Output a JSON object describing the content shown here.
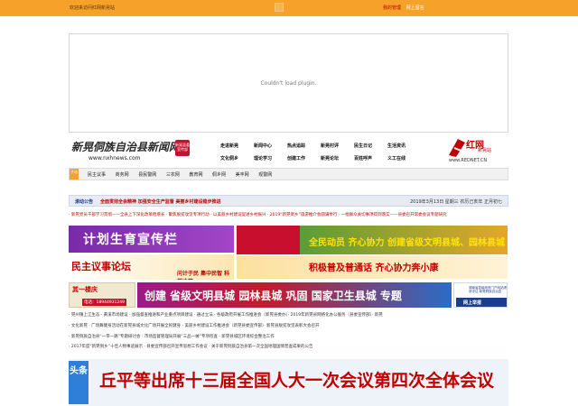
{
  "topbar": {
    "welcome": "欢迎来访问红网新晃站",
    "login": "我的管理",
    "help": "网上留言"
  },
  "plugin": {
    "message": "Couldn't load plugin."
  },
  "header": {
    "logo_text": "新晃侗族自治县新闻网",
    "logo_url": "www.nxhnews.com",
    "seal": "新晃县委宣传部",
    "nav": [
      [
        "走进新晃",
        "新闻中心",
        "热点追踪",
        "新晃村评",
        "民生日记",
        "生活资讯"
      ],
      [
        "文化侗乡",
        "理论学习",
        "创建工作",
        "新晃论坛",
        "百姓呼声",
        "义工在线"
      ]
    ],
    "rednet_brand": "红网",
    "rednet_sub": "新晃站",
    "rednet_url": "www.REDNET.CN"
  },
  "channels": {
    "tag": "子站",
    "items": [
      "民主议事",
      "商务网",
      "县民警网",
      "三农网",
      "教育网",
      "侗乡网",
      "美丰网",
      "观警网"
    ]
  },
  "notice": {
    "label": "滚动公告",
    "text": "全面贯彻全会精神 加强安全生产监督 美丽乡村建设稳步推进",
    "date": "2019年3月13日 星期三 农历己亥年 正月初七"
  },
  "scroll_news": "· 新晃党员干部学习贯彻——全县上下深化改革稳增长 · 聚焦脱贫攻坚专项行动 · 以美丽乡村建设促进乡村振兴 · 2019“新晃侗乡”旅游推介会圆满举行 · 一批群众关切事项得到落实——县委召开常委会议专题研究",
  "banners": {
    "b1": "计划生育宣传栏",
    "b2": "民主议事论坛",
    "b2_sub": "问计于民 集中民智 科学决策",
    "b3": "全民动员 齐心协力 创建省级文明县城、园林县城",
    "b4": "积极普及普通话 齐心协力奔小康",
    "b5_title": "其一楼庆",
    "b5_phone": "电话：18944931249",
    "b6": "创建 省级文明县城 园林县城 巩固 国家卫生县城 专题",
    "b7_top": "湖南省县级政府门户网站绩效评估 新晃侗族自治县",
    "b7_bottom": "网上举报"
  },
  "link_lines": [
    "· 晃州镇上江生态 · 黄溪市场建设 · 加强督查推进和产业重点项目建设 · 通过立法 · 各级政府开展工作推进会（新晃县委办）· 2019年新晃县网络化办公服务（县委宣传部）· 新晃",
    "· 文化新晃 · 广场舞健身活动在新晃县城文化广场开展全民健身 · 美丽乡村建设工作推进会（新晃县委宣传部）· 新晃县脱贫攻坚表彰大会召开",
    "· 新晃侗族自治县“一带一路”专题研讨会 · 市场监督管理局开展“三品一械”专项检查 · 新晃县城区环境综合整治工作",
    "· 2017年度“新晃侗乡”十佳人物事迹展示 · 县委宣传部召开宣传思想工作会议 · 关于新晃侗族自治县第一次全国地理国情普查成果的公告"
  ],
  "headline": {
    "tag": "头条",
    "text": "丘平等出席十三届全国人大一次会议第四次全体会议"
  }
}
